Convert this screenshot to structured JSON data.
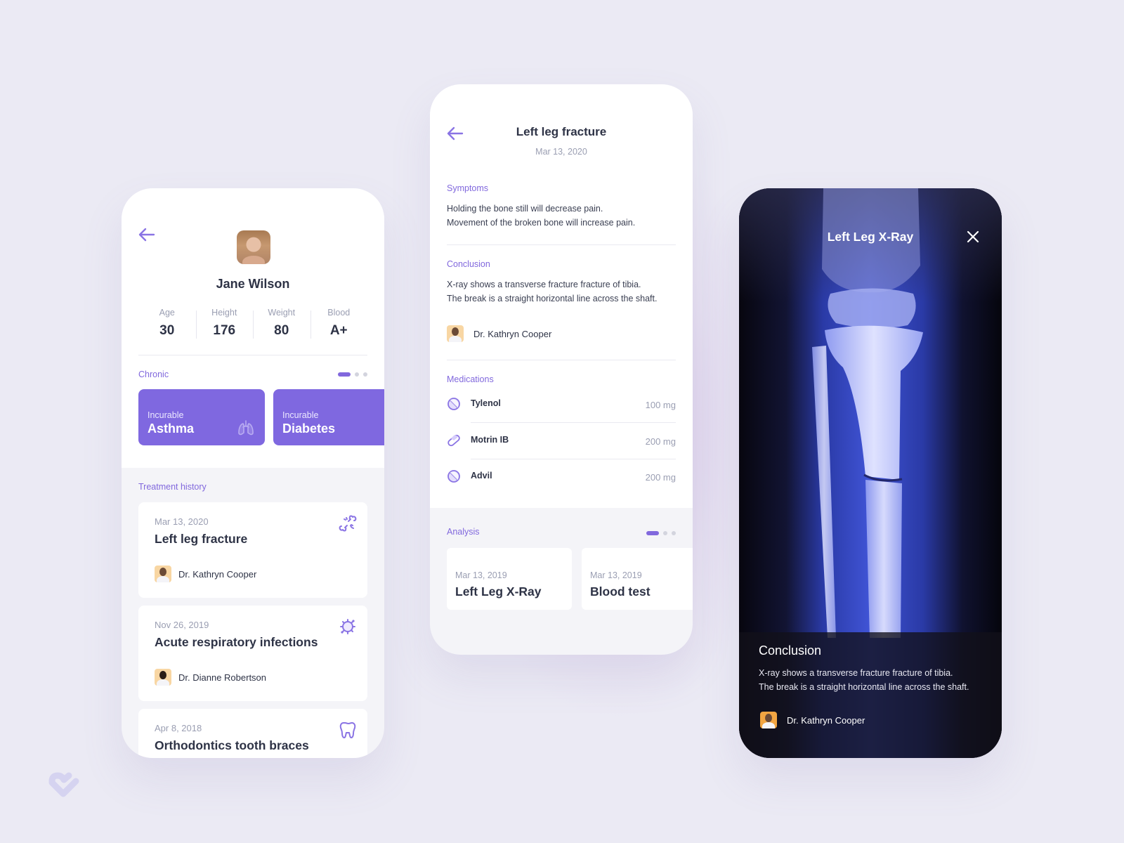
{
  "brand": {
    "accent": "#7f68e0",
    "label_color": "#8168dd",
    "background": "#ebeaf4"
  },
  "patient_screen": {
    "back_icon": "arrow-left-icon",
    "patient_name": "Jane Wilson",
    "stats": [
      {
        "label": "Age",
        "value": "30"
      },
      {
        "label": "Height",
        "value": "176"
      },
      {
        "label": "Weight",
        "value": "80"
      },
      {
        "label": "Blood",
        "value": "A+"
      }
    ],
    "chronic": {
      "label": "Chronic",
      "pager": {
        "pages": 3,
        "active": 1
      },
      "cards": [
        {
          "subtitle": "Incurable",
          "title": "Asthma",
          "icon": "lungs-icon"
        },
        {
          "subtitle": "Incurable",
          "title": "Diabetes",
          "icon": "drop-icon"
        }
      ]
    },
    "treatment_history": {
      "label": "Treatment history",
      "items": [
        {
          "date": "Mar 13, 2020",
          "title": "Left leg fracture",
          "doctor": "Dr. Kathryn Cooper",
          "icon": "broken-bone-icon"
        },
        {
          "date": "Nov 26, 2019",
          "title": "Acute respiratory infections",
          "doctor": "Dr. Dianne Robertson",
          "icon": "virus-icon"
        },
        {
          "date": "Apr 8, 2018",
          "title": "Orthodontics tooth braces",
          "doctor": "",
          "icon": "tooth-icon"
        }
      ]
    }
  },
  "detail_screen": {
    "title": "Left leg fracture",
    "date": "Mar 13, 2020",
    "symptoms": {
      "label": "Symptoms",
      "lines": [
        "Holding the bone still will decrease pain.",
        "Movement of the broken bone will increase pain."
      ]
    },
    "conclusion": {
      "label": "Conclusion",
      "lines": [
        "X-ray shows a transverse fracture fracture of tibia.",
        "The break is a straight horizontal line across the shaft."
      ],
      "doctor": "Dr. Kathryn Cooper"
    },
    "medications": {
      "label": "Medications",
      "items": [
        {
          "name": "Tylenol",
          "dose": "100 mg",
          "icon": "tablet-icon"
        },
        {
          "name": "Motrin IB",
          "dose": "200 mg",
          "icon": "capsule-icon"
        },
        {
          "name": "Advil",
          "dose": "200 mg",
          "icon": "tablet-icon"
        }
      ]
    },
    "analysis": {
      "label": "Analysis",
      "pager": {
        "pages": 3,
        "active": 1
      },
      "items": [
        {
          "date": "Mar 13, 2019",
          "title": "Left Leg X-Ray"
        },
        {
          "date": "Mar 13, 2019",
          "title": "Blood test"
        }
      ]
    }
  },
  "xray_screen": {
    "title": "Left Leg X-Ray",
    "close_icon": "close-icon",
    "conclusion_title": "Conclusion",
    "lines": [
      "X-ray shows a transverse fracture fracture of tibia.",
      "The break is a straight horizontal line across the shaft."
    ],
    "doctor": "Dr. Kathryn Cooper"
  }
}
